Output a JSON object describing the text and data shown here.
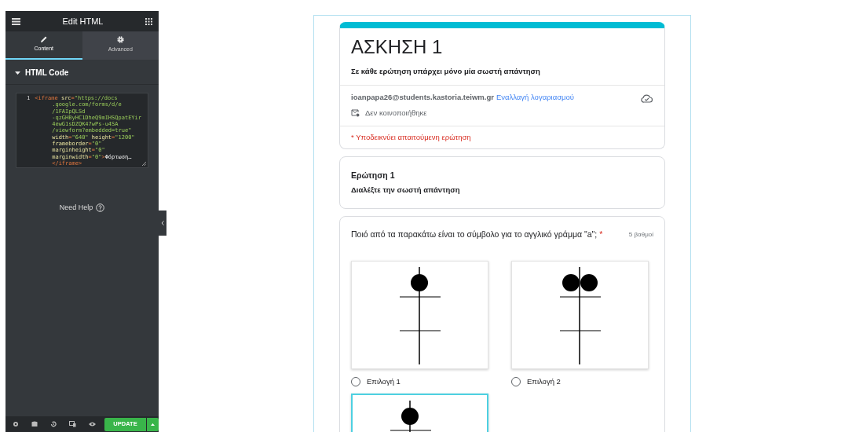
{
  "panel": {
    "title": "Edit HTML",
    "tabs": [
      {
        "label": "Content",
        "selected": true
      },
      {
        "label": "Advanced",
        "selected": false
      }
    ],
    "section": {
      "label": "HTML Code",
      "expanded": true
    },
    "code": {
      "line_number": "1",
      "lines": [
        [
          {
            "kind": "tag",
            "text": "<iframe"
          },
          {
            "kind": "attr",
            "text": "src"
          },
          {
            "kind": "tag",
            "text": "="
          },
          {
            "kind": "value",
            "text": "\"https://docs"
          }
        ],
        [
          {
            "kind": "value",
            "text": ".google.com/forms/d/e"
          }
        ],
        [
          {
            "kind": "value",
            "text": "/1FAIpQLSd"
          }
        ],
        [
          {
            "kind": "value",
            "text": "-qzGHByHC1DheQ9mIHSQpatEYir"
          }
        ],
        [
          {
            "kind": "value",
            "text": "4ewG1sDZQK47wPs-u4SA"
          }
        ],
        [
          {
            "kind": "value",
            "text": "/viewform?embedded=true\""
          }
        ],
        [
          {
            "kind": "attr",
            "text": "width"
          },
          {
            "kind": "tag",
            "text": "="
          },
          {
            "kind": "value",
            "text": "\"640\""
          },
          {
            "kind": "attr",
            "text": "height"
          },
          {
            "kind": "tag",
            "text": "="
          },
          {
            "kind": "value",
            "text": "\"1200\""
          }
        ],
        [
          {
            "kind": "attr",
            "text": "frameborder"
          },
          {
            "kind": "tag",
            "text": "="
          },
          {
            "kind": "value",
            "text": "\"0\""
          }
        ],
        [
          {
            "kind": "attr",
            "text": "marginheight"
          },
          {
            "kind": "tag",
            "text": "="
          },
          {
            "kind": "value",
            "text": "\"0\""
          }
        ],
        [
          {
            "kind": "attr",
            "text": "marginwidth"
          },
          {
            "kind": "tag",
            "text": "="
          },
          {
            "kind": "value",
            "text": "\"0\""
          },
          {
            "kind": "tag",
            "text": ">"
          },
          {
            "kind": "plain",
            "text": "Φόρτωση…"
          }
        ],
        [
          {
            "kind": "tag",
            "text": "</iframe>"
          }
        ]
      ]
    },
    "help": "Need Help",
    "update": "UPDATE"
  },
  "form": {
    "title": "ΑΣΚΗΣΗ 1",
    "description": "Σε κάθε ερώτηση υπάρχει μόνο μία σωστή απάντηση",
    "email": "ioanpapa26@students.kastoria.teiwm.gr",
    "switch_account": "Εναλλαγή λογαριασμού",
    "not_shared": "Δεν κοινοποιήθηκε",
    "required_note": "* Υποδεικνύει απαιτούμενη ερώτηση",
    "section": {
      "title": "Ερώτηση 1",
      "subtitle": "Διαλέξτε την σωστή απάντηση"
    },
    "question": {
      "text": "Ποιό από τα παρακάτω είναι το σύμβολο για το αγγλικό γράμμα \"a\";",
      "required_mark": "*",
      "points": "5 βαθμοί",
      "options": [
        {
          "label": "Επιλογή 1",
          "selected": false,
          "focused": false
        },
        {
          "label": "Επιλογή 2",
          "selected": false,
          "focused": false
        },
        {
          "focused": true
        }
      ]
    }
  }
}
